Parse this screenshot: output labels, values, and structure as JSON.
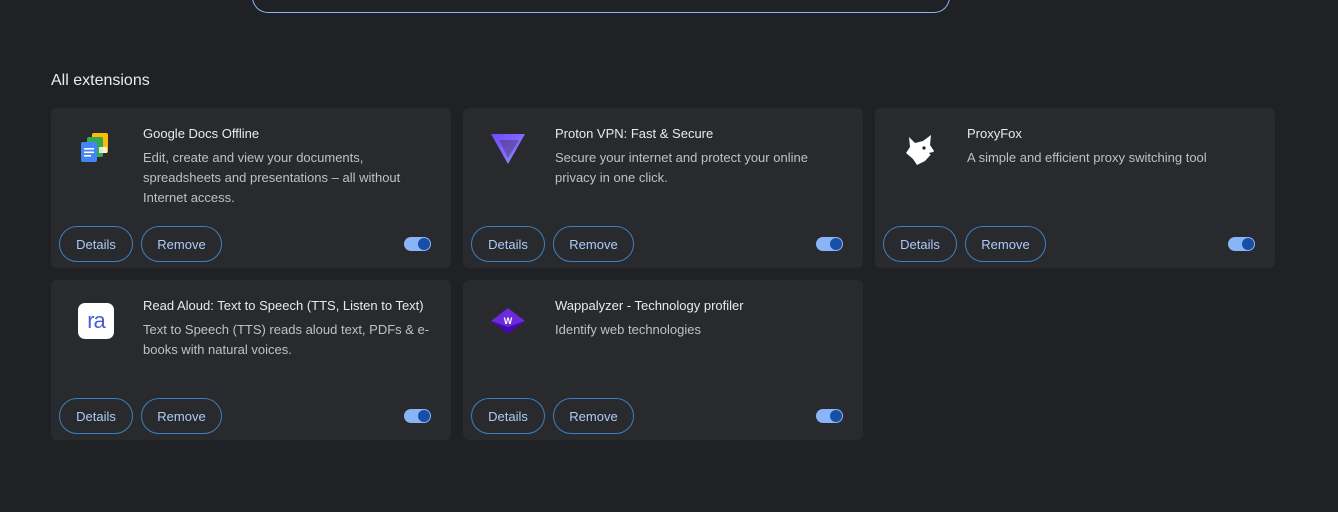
{
  "section_title": "All extensions",
  "buttons": {
    "details": "Details",
    "remove": "Remove"
  },
  "extensions": [
    {
      "name": "Google Docs Offline",
      "description": "Edit, create and view your documents, spreadsheets and presentations – all without Internet access.",
      "icon": "google-docs-offline-icon",
      "enabled": true
    },
    {
      "name": "Proton VPN: Fast & Secure",
      "description": "Secure your internet and protect your online privacy in one click.",
      "icon": "proton-vpn-icon",
      "enabled": true
    },
    {
      "name": "ProxyFox",
      "description": "A simple and efficient proxy switching tool",
      "icon": "proxyfox-icon",
      "enabled": true
    },
    {
      "name": "Read Aloud: Text to Speech (TTS, Listen to Text)",
      "description": "Text to Speech (TTS) reads aloud text, PDFs & e-books with natural voices.",
      "icon": "read-aloud-icon",
      "icon_text": "ra",
      "enabled": true
    },
    {
      "name": "Wappalyzer - Technology profiler",
      "description": "Identify web technologies",
      "icon": "wappalyzer-icon",
      "icon_text": "W",
      "enabled": true
    }
  ],
  "colors": {
    "background": "#202124",
    "card": "#292a2d",
    "accent": "#8ab4f8",
    "button_text": "#aecbfa"
  }
}
